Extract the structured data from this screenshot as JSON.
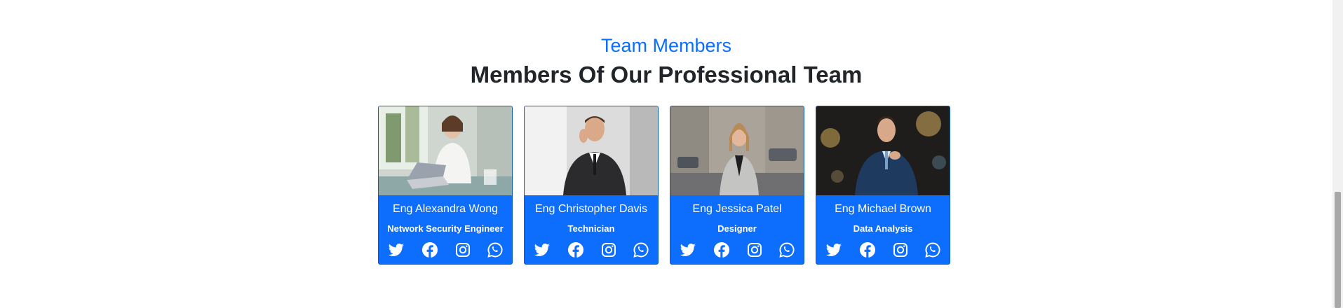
{
  "section": {
    "eyebrow": "Team Members",
    "heading": "Members Of Our Professional Team"
  },
  "theme": {
    "accent": "#0d6efd",
    "heading_color": "#212529",
    "card_text": "#ffffff"
  },
  "members": [
    {
      "name": "Eng Alexandra Wong",
      "role": "Network Security Engineer",
      "photo": "woman-working-at-laptop-office-photo",
      "socials": [
        "twitter-icon",
        "facebook-icon",
        "instagram-icon",
        "whatsapp-icon"
      ]
    },
    {
      "name": "Eng Christopher Davis",
      "role": "Technician",
      "photo": "man-in-suit-on-phone-photo",
      "socials": [
        "twitter-icon",
        "facebook-icon",
        "instagram-icon",
        "whatsapp-icon"
      ]
    },
    {
      "name": "Eng Jessica Patel",
      "role": "Designer",
      "photo": "woman-on-city-street-photo",
      "socials": [
        "twitter-icon",
        "facebook-icon",
        "instagram-icon",
        "whatsapp-icon"
      ]
    },
    {
      "name": "Eng Michael Brown",
      "role": "Data Analysis",
      "photo": "man-adjusting-tie-night-photo",
      "socials": [
        "twitter-icon",
        "facebook-icon",
        "instagram-icon",
        "whatsapp-icon"
      ]
    }
  ]
}
